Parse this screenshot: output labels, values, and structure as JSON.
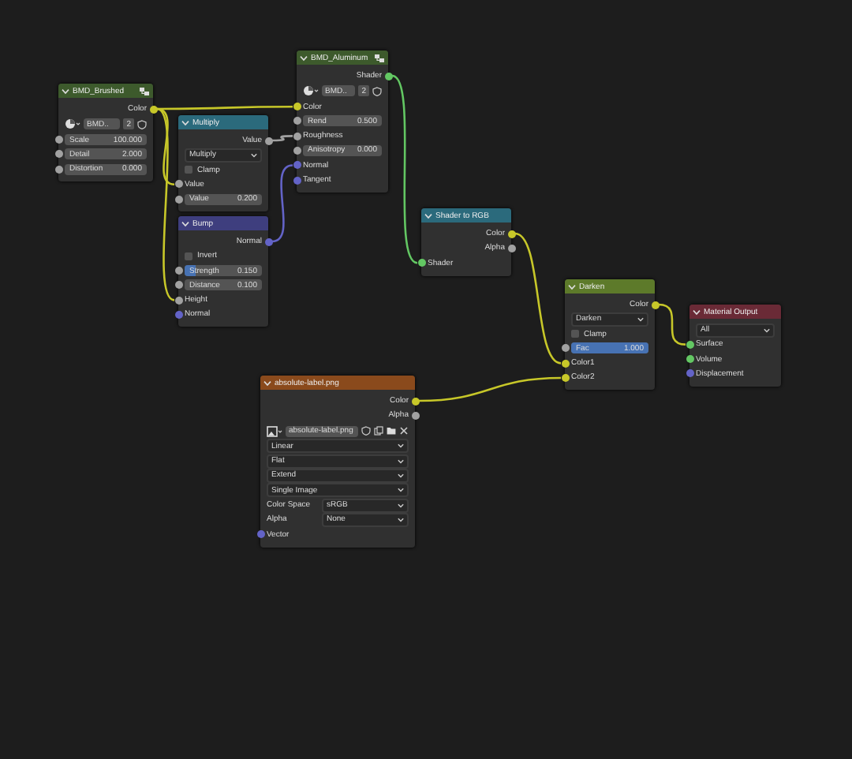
{
  "nodes": [
    {
      "title": "BMD_Brushed",
      "color": "#3d5a2c",
      "group": true,
      "rows": [
        {
          "kind": "out",
          "label": "Color",
          "color": "#c7c729"
        },
        {
          "kind": "image",
          "name": "BMD..",
          "count": "2"
        },
        {
          "kind": "field",
          "label": "Scale",
          "value": "100.000",
          "color": "#a1a1a1"
        },
        {
          "kind": "field",
          "label": "Detail",
          "value": "2.000",
          "color": "#a1a1a1"
        },
        {
          "kind": "field",
          "label": "Distortion",
          "value": "0.000",
          "color": "#a1a1a1"
        }
      ]
    },
    {
      "title": "Multiply",
      "color": "#2b6a7c",
      "group": false,
      "rows": [
        {
          "kind": "out",
          "label": "Value",
          "color": "#a1a1a1"
        },
        {
          "kind": "dropdown",
          "value": "Multiply"
        },
        {
          "kind": "checkbox",
          "label": "Clamp",
          "checked": false
        },
        {
          "kind": "in",
          "label": "Value",
          "color": "#a1a1a1"
        },
        {
          "kind": "field",
          "label": "Value",
          "value": "0.200",
          "color": "#a1a1a1"
        }
      ]
    },
    {
      "title": "Bump",
      "color": "#3e3e7e",
      "group": false,
      "rows": [
        {
          "kind": "out",
          "label": "Normal",
          "color": "#6363c7"
        },
        {
          "kind": "checkbox",
          "label": "Invert",
          "checked": false
        },
        {
          "kind": "field",
          "label": "Strength",
          "value": "0.150",
          "color": "#a1a1a1",
          "level": 0.15
        },
        {
          "kind": "field",
          "label": "Distance",
          "value": "0.100",
          "color": "#a1a1a1"
        },
        {
          "kind": "in",
          "label": "Height",
          "color": "#a1a1a1"
        },
        {
          "kind": "in",
          "label": "Normal",
          "color": "#6363c7"
        }
      ]
    },
    {
      "title": "BMD_Aluminum",
      "color": "#3d5a2c",
      "group": true,
      "rows": [
        {
          "kind": "out",
          "label": "Shader",
          "color": "#63c763"
        },
        {
          "kind": "image",
          "name": "BMD..",
          "count": "2"
        },
        {
          "kind": "in",
          "label": "Color",
          "color": "#c7c729"
        },
        {
          "kind": "field",
          "label": "Rend",
          "value": "0.500",
          "color": "#a1a1a1"
        },
        {
          "kind": "in",
          "label": "Roughness",
          "color": "#a1a1a1"
        },
        {
          "kind": "field",
          "label": "Anisotropy",
          "value": "0.000",
          "color": "#a1a1a1"
        },
        {
          "kind": "in",
          "label": "Normal",
          "color": "#6363c7"
        },
        {
          "kind": "in",
          "label": "Tangent",
          "color": "#6363c7"
        }
      ]
    },
    {
      "title": "Shader to RGB",
      "color": "#2b6a7c",
      "group": false,
      "rows": [
        {
          "kind": "out",
          "label": "Color",
          "color": "#c7c729"
        },
        {
          "kind": "out",
          "label": "Alpha",
          "color": "#a1a1a1"
        },
        {
          "kind": "in",
          "label": "Shader",
          "color": "#63c763"
        }
      ]
    },
    {
      "title": "Darken",
      "color": "#5d7a2a",
      "group": false,
      "rows": [
        {
          "kind": "out",
          "label": "Color",
          "color": "#c7c729"
        },
        {
          "kind": "dropdown",
          "value": "Darken"
        },
        {
          "kind": "checkbox",
          "label": "Clamp",
          "checked": false
        },
        {
          "kind": "field",
          "label": "Fac",
          "value": "1.000",
          "color": "#a1a1a1",
          "level": 1
        },
        {
          "kind": "in",
          "label": "Color1",
          "color": "#c7c729"
        },
        {
          "kind": "in",
          "label": "Color2",
          "color": "#c7c729"
        }
      ]
    },
    {
      "title": "Material Output",
      "color": "#6a2a36",
      "group": false,
      "rows": [
        {
          "kind": "dropdown",
          "value": "All"
        },
        {
          "kind": "in",
          "label": "Surface",
          "color": "#63c763"
        },
        {
          "kind": "in",
          "label": "Volume",
          "color": "#63c763"
        },
        {
          "kind": "in",
          "label": "Displacement",
          "color": "#6363c7"
        }
      ]
    },
    {
      "title": "absolute-label.png",
      "color": "#8a4a1c",
      "group": false,
      "rows": [
        {
          "kind": "out",
          "label": "Color",
          "color": "#c7c729"
        },
        {
          "kind": "out",
          "label": "Alpha",
          "color": "#a1a1a1"
        },
        {
          "kind": "imagefile",
          "name": "absolute-label.png"
        },
        {
          "kind": "dropdown",
          "value": "Linear"
        },
        {
          "kind": "dropdown",
          "value": "Flat"
        },
        {
          "kind": "dropdown",
          "value": "Extend"
        },
        {
          "kind": "dropdown",
          "value": "Single Image"
        },
        {
          "kind": "prop",
          "label": "Color Space",
          "value": "sRGB"
        },
        {
          "kind": "prop",
          "label": "Alpha",
          "value": "None"
        },
        {
          "kind": "in",
          "label": "Vector",
          "color": "#6363c7"
        }
      ]
    }
  ]
}
